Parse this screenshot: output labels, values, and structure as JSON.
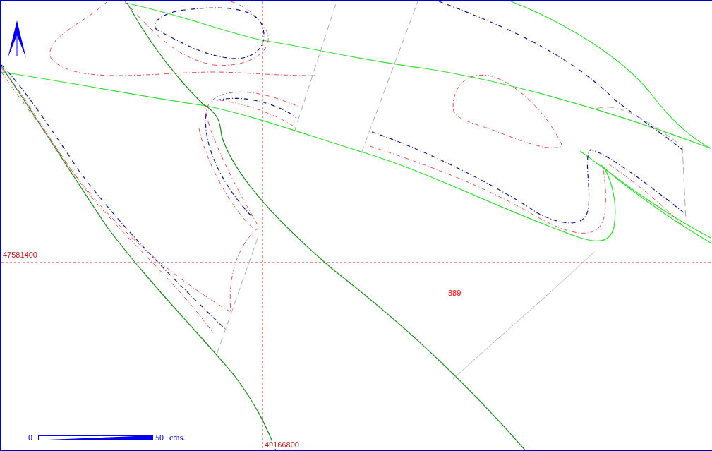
{
  "map": {
    "grid": {
      "northing": "47581400",
      "easting": "49166800"
    },
    "parcel_label": "889",
    "scale_bar": {
      "start": "0",
      "end": "50",
      "unit": "cms."
    }
  }
}
